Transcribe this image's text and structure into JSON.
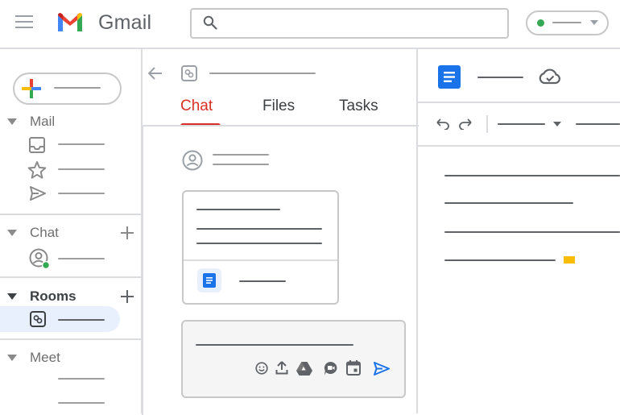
{
  "header": {
    "app_title": "Gmail",
    "menu_icon": "hamburger-menu-icon",
    "logo_icon": "gmail-logo-icon",
    "search_icon": "search-icon",
    "status_color": "#34a853"
  },
  "sidebar": {
    "sections": [
      {
        "label": "Mail",
        "items": [
          "inbox-icon",
          "star-icon",
          "send-icon"
        ]
      },
      {
        "label": "Chat",
        "items": [
          "person-icon"
        ]
      },
      {
        "label": "Rooms",
        "items": [
          "room-icon"
        ]
      },
      {
        "label": "Meet",
        "items": []
      }
    ]
  },
  "room": {
    "tabs": [
      "Chat",
      "Files",
      "Tasks"
    ],
    "active_tab": "Chat"
  },
  "colors": {
    "accent_red": "#d93025",
    "docs_blue": "#1a73e8",
    "send_blue": "#1a73e8",
    "online_green": "#34a853",
    "cursor_yellow": "#fbbc04",
    "active_bg": "#e8f0fe"
  }
}
